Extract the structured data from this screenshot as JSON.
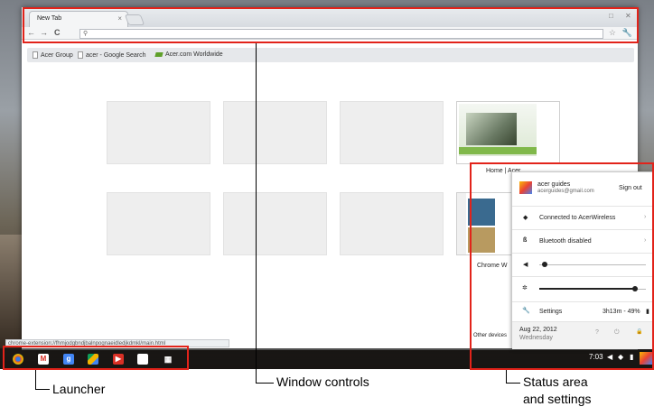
{
  "tab": {
    "title": "New Tab",
    "close_glyph": "×"
  },
  "window_controls": {
    "minimize_glyph": "□",
    "close_glyph": "✕"
  },
  "toolbar": {
    "back_glyph": "←",
    "forward_glyph": "→",
    "reload_glyph": "C",
    "search_glyph": "⚲",
    "star_glyph": "☆",
    "wrench_glyph": "🔧"
  },
  "bookmarks": [
    {
      "label": "Acer Group"
    },
    {
      "label": "acer - Google Search"
    },
    {
      "label": "Acer.com Worldwide"
    }
  ],
  "thumbnails": {
    "home_label": "Home | Acer",
    "chrome_label": "Chrome W",
    "other_devices": "Other devices"
  },
  "status_url": "chrome-extension://fhmjodgbndjbalnpognaeidledjkdmkl/main.html",
  "shelf": {
    "apps": [
      "chrome-icon",
      "gmail-icon",
      "google-search-icon",
      "drive-icon",
      "youtube-icon",
      "docs-icon",
      "app-launcher-icon"
    ],
    "time": "7:03"
  },
  "status_bubble": {
    "user_name": "acer guides",
    "user_email": "acerguides@gmail.com",
    "sign_out": "Sign out",
    "wifi": "Connected to AcerWireless",
    "bluetooth": "Bluetooth disabled",
    "volume_level": 0.05,
    "brightness_level": 0.9,
    "settings": "Settings",
    "battery": "3h13m - 49%",
    "date": "Aug 22, 2012",
    "weekday": "Wednesday",
    "help_glyph": "?",
    "power_glyph": "⏻",
    "lock_glyph": "🔒"
  },
  "callouts": {
    "launcher": "Launcher",
    "window_controls": "Window controls",
    "status_area_1": "Status area",
    "status_area_2": "and settings"
  },
  "colors": {
    "callout": "#e2231a",
    "shelf": "#141414",
    "acer_green": "#80b84a"
  }
}
